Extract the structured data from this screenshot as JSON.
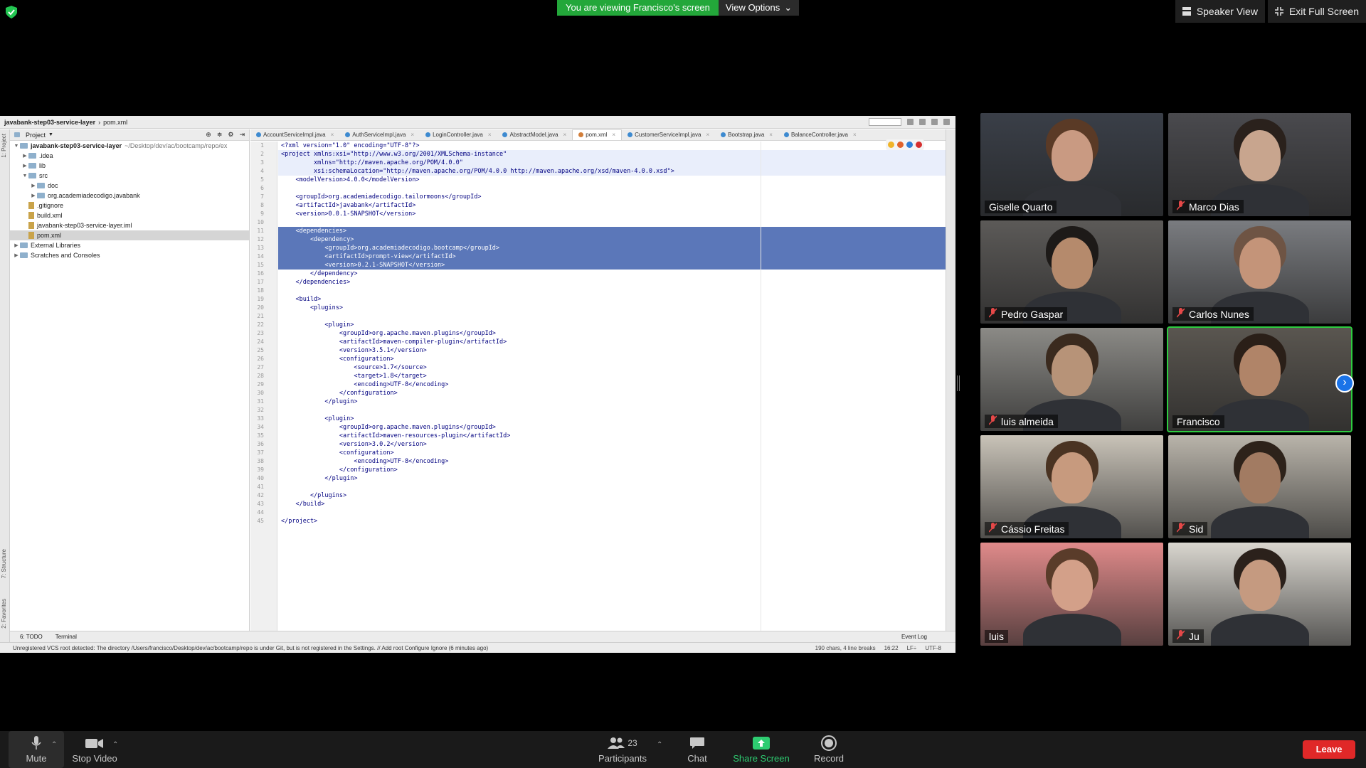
{
  "banner": {
    "viewing_text": "You are viewing Francisco's screen",
    "view_options": "View Options"
  },
  "top_right": {
    "speaker_view": "Speaker View",
    "exit_full_screen": "Exit Full Screen"
  },
  "ide": {
    "breadcrumb": [
      "javabank-step03-service-layer",
      "pom.xml"
    ],
    "project_label": "Project",
    "tree": [
      {
        "label": "javabank-step03-service-layer",
        "path": "~/Desktop/dev/ac/bootcamp/repo/ex",
        "type": "folder",
        "depth": 0,
        "open": true
      },
      {
        "label": ".idea",
        "type": "folder",
        "depth": 1,
        "open": false
      },
      {
        "label": "lib",
        "type": "folder",
        "depth": 1,
        "open": false
      },
      {
        "label": "src",
        "type": "folder",
        "depth": 1,
        "open": true
      },
      {
        "label": "doc",
        "type": "folder",
        "depth": 2,
        "open": false
      },
      {
        "label": "org.academiadecodigo.javabank",
        "type": "folder",
        "depth": 2,
        "open": false
      },
      {
        "label": ".gitignore",
        "type": "file",
        "depth": 1
      },
      {
        "label": "build.xml",
        "type": "file",
        "depth": 1
      },
      {
        "label": "javabank-step03-service-layer.iml",
        "type": "file",
        "depth": 1
      },
      {
        "label": "pom.xml",
        "type": "file",
        "depth": 1,
        "selected": true
      },
      {
        "label": "External Libraries",
        "type": "folder",
        "depth": 0,
        "open": false
      },
      {
        "label": "Scratches and Consoles",
        "type": "folder",
        "depth": 0
      }
    ],
    "tabs": [
      {
        "label": "AccountServiceImpl.java",
        "active": false
      },
      {
        "label": "AuthServiceImpl.java",
        "active": false
      },
      {
        "label": "LoginController.java",
        "active": false
      },
      {
        "label": "AbstractModel.java",
        "active": false
      },
      {
        "label": "pom.xml",
        "active": true
      },
      {
        "label": "CustomerServiceImpl.java",
        "active": false
      },
      {
        "label": "Bootstrap.java",
        "active": false
      },
      {
        "label": "BalanceController.java",
        "active": false
      }
    ],
    "code_lines": [
      "<?xml version=\"1.0\" encoding=\"UTF-8\"?>",
      "<project xmlns:xsi=\"http://www.w3.org/2001/XMLSchema-instance\"",
      "         xmlns=\"http://maven.apache.org/POM/4.0.0\"",
      "         xsi:schemaLocation=\"http://maven.apache.org/POM/4.0.0 http://maven.apache.org/xsd/maven-4.0.0.xsd\">",
      "    <modelVersion>4.0.0</modelVersion>",
      "",
      "    <groupId>org.academiadecodigo.tailormoons</groupId>",
      "    <artifactId>javabank</artifactId>",
      "    <version>0.0.1-SNAPSHOT</version>",
      "",
      "    <dependencies>",
      "        <dependency>",
      "            <groupId>org.academiadecodigo.bootcamp</groupId>",
      "            <artifactId>prompt-view</artifactId>",
      "            <version>0.2.1-SNAPSHOT</version>",
      "        </dependency>",
      "    </dependencies>",
      "",
      "    <build>",
      "        <plugins>",
      "",
      "            <plugin>",
      "                <groupId>org.apache.maven.plugins</groupId>",
      "                <artifactId>maven-compiler-plugin</artifactId>",
      "                <version>3.5.1</version>",
      "                <configuration>",
      "                    <source>1.7</source>",
      "                    <target>1.8</target>",
      "                    <encoding>UTF-8</encoding>",
      "                </configuration>",
      "            </plugin>",
      "",
      "            <plugin>",
      "                <groupId>org.apache.maven.plugins</groupId>",
      "                <artifactId>maven-resources-plugin</artifactId>",
      "                <version>3.0.2</version>",
      "                <configuration>",
      "                    <encoding>UTF-8</encoding>",
      "                </configuration>",
      "            </plugin>",
      "",
      "        </plugins>",
      "    </build>",
      "",
      "</project>"
    ],
    "bottom_tools": {
      "todo": "6: TODO",
      "terminal": "Terminal",
      "event_log": "Event Log"
    },
    "left_strip": {
      "project": "1: Project",
      "structure": "7: Structure",
      "favorites": "2: Favorites"
    },
    "status": {
      "message": "Unregistered VCS root detected: The directory /Users/francisco/Desktop/dev/ac/bootcamp/repo is under Git, but is not registered in the Settings. // Add root  Configure  Ignore (6 minutes ago)",
      "chars": "190 chars, 4 line breaks",
      "position": "16:22",
      "line_sep": "LF÷",
      "encoding": "UTF-8"
    }
  },
  "participants": [
    {
      "name": "Giselle Quarto",
      "muted": false,
      "bg": "#3a3f48",
      "face": "#c99a82",
      "hair": "#5a3a26"
    },
    {
      "name": "Marco Dias",
      "muted": true,
      "bg": "#4a4a4e",
      "face": "#c8a58e",
      "hair": "#2a211c"
    },
    {
      "name": "Pedro Gaspar",
      "muted": true,
      "bg": "#5c5a58",
      "face": "#b58a6c",
      "hair": "#1d1a18"
    },
    {
      "name": "Carlos Nunes",
      "muted": true,
      "bg": "#7a7c80",
      "face": "#c49479",
      "hair": "#6e5444"
    },
    {
      "name": "luis almeida",
      "muted": true,
      "bg": "#8b8a86",
      "face": "#b79378",
      "hair": "#3a2a1e"
    },
    {
      "name": "Francisco",
      "muted": false,
      "bg": "#5a5650",
      "face": "#b08468",
      "hair": "#2a1f18",
      "active": true
    },
    {
      "name": "Cássio Freitas",
      "muted": true,
      "bg": "#c9c3b8",
      "face": "#c79a7e",
      "hair": "#4a3322"
    },
    {
      "name": "Sid",
      "muted": true,
      "bg": "#b9b4aa",
      "face": "#a27b62",
      "hair": "#2d221a"
    },
    {
      "name": "luis",
      "muted": false,
      "bg": "#e08a8a",
      "face": "#d3a089",
      "hair": "#5a3c2a"
    },
    {
      "name": "Ju",
      "muted": true,
      "bg": "#d9d6cf",
      "face": "#c59a80",
      "hair": "#2b211b"
    }
  ],
  "toolbar": {
    "mute": "Mute",
    "stop_video": "Stop Video",
    "participants": "Participants",
    "participant_count": "23",
    "chat": "Chat",
    "share_screen": "Share Screen",
    "record": "Record",
    "leave": "Leave"
  }
}
